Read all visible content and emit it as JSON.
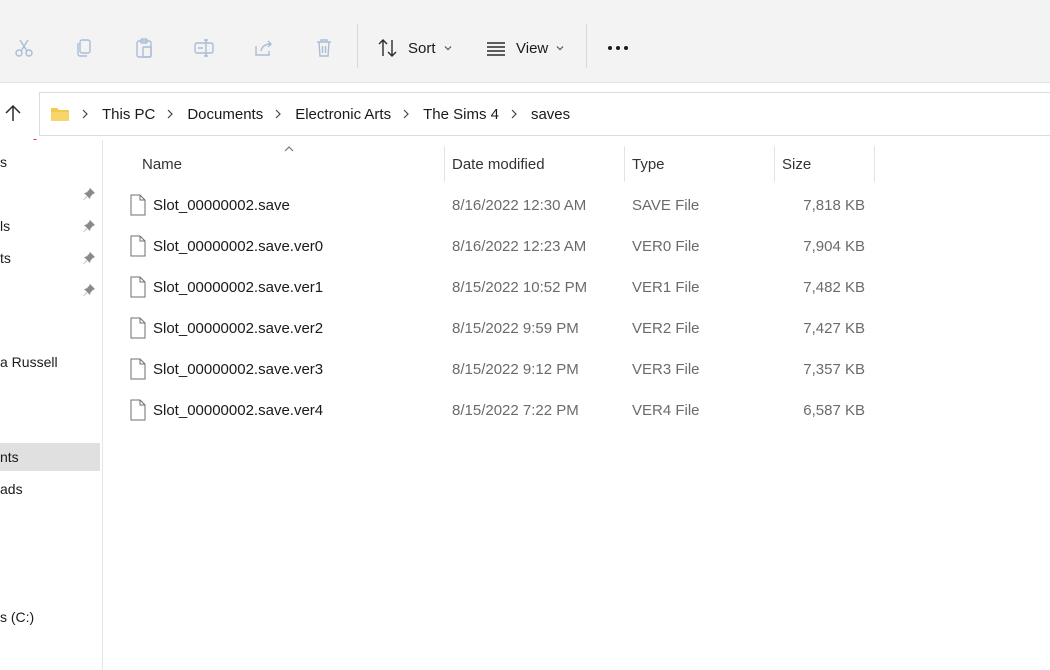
{
  "toolbar": {
    "cut_icon": "cut-icon",
    "copy_icon": "copy-icon",
    "paste_icon": "paste-icon",
    "rename_icon": "rename-icon",
    "share_icon": "share-icon",
    "delete_icon": "delete-icon",
    "sort_label": "Sort",
    "view_label": "View",
    "more_icon": "more-icon"
  },
  "address": {
    "crumbs": [
      "This PC",
      "Documents",
      "Electronic Arts",
      "The Sims 4",
      "saves"
    ]
  },
  "nav": {
    "items": [
      "s",
      "ls",
      "ts",
      "a Russell",
      "nts",
      "ads",
      "s (C:)"
    ]
  },
  "columns": {
    "name": "Name",
    "date": "Date modified",
    "type": "Type",
    "size": "Size"
  },
  "files": [
    {
      "name": "Slot_00000002.save",
      "date": "8/16/2022 12:30 AM",
      "type": "SAVE File",
      "size": "7,818 KB"
    },
    {
      "name": "Slot_00000002.save.ver0",
      "date": "8/16/2022 12:23 AM",
      "type": "VER0 File",
      "size": "7,904 KB"
    },
    {
      "name": "Slot_00000002.save.ver1",
      "date": "8/15/2022 10:52 PM",
      "type": "VER1 File",
      "size": "7,482 KB"
    },
    {
      "name": "Slot_00000002.save.ver2",
      "date": "8/15/2022 9:59 PM",
      "type": "VER2 File",
      "size": "7,427 KB"
    },
    {
      "name": "Slot_00000002.save.ver3",
      "date": "8/15/2022 9:12 PM",
      "type": "VER3 File",
      "size": "7,357 KB"
    },
    {
      "name": "Slot_00000002.save.ver4",
      "date": "8/15/2022 7:22 PM",
      "type": "VER4 File",
      "size": "6,587 KB"
    }
  ],
  "colors": {
    "toolbar_bg": "#f3f3f3",
    "selected_nav_bg": "#e0e0e0",
    "folder_yellow": "#f2c94c",
    "disabled_icon": "#a9bdd6",
    "indicator_red": "#e81123"
  }
}
